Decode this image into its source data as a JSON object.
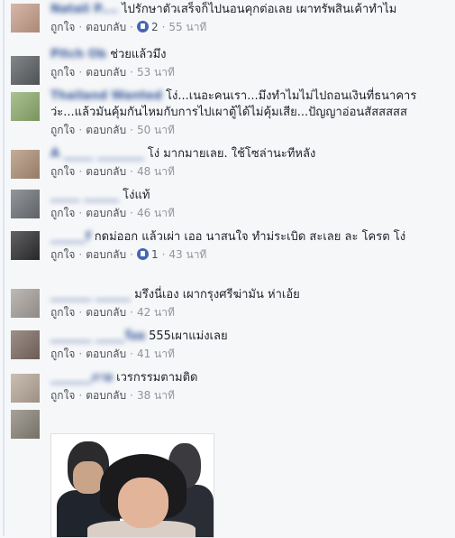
{
  "actions": {
    "like": "ถูกใจ",
    "reply": "ตอบกลับ",
    "sep": "·"
  },
  "comments": [
    {
      "name": "Natali P....",
      "text": "ไปรักษาตัวเสร็จก็ไปนอนคุกต่อเลย เผาทรัพสินเค้าทำไม",
      "likes": "2",
      "time": "55 นาที",
      "avatar_color": "#c9a08c"
    },
    {
      "name": "Pitch Ob",
      "text": "ช่วยแล้วมึง",
      "likes": "",
      "time": "53 นาที",
      "avatar_color": "#5b5f63"
    },
    {
      "name": "Thailand Wanted",
      "text": "โง่...เนอะคนเรา...มึงทำไมไม่ไปถอนเงินที่ธนาคาร ว่ะ...แล้วมันคุ้มกันไหมกับการไปเผาตู้ได้ไม่คุ้มเสีย...ปัญญาอ่อนสัสสสสส",
      "likes": "",
      "time": "50 นาที",
      "avatar_color": "#8fae6e"
    },
    {
      "name": "A _____ ________",
      "text": "โง่ มากมายเลย. ใช้โซล่านะทีหลัง",
      "likes": "",
      "time": "48 นาที",
      "avatar_color": "#b09178"
    },
    {
      "name": "_____ ______",
      "text": "โง่แท้",
      "likes": "",
      "time": "46 นาที",
      "avatar_color": "#6f7378"
    },
    {
      "name": "______f",
      "text": "กดม่ออก แล้วเผ่า เออ นาสนใจ ทำม่ระเบิด สะเลย ละ โครต โง่",
      "likes": "1",
      "time": "43 นาที",
      "avatar_color": "#2e2e31"
    },
    {
      "name": "_______ ______",
      "text": "มรึงนี่เอง เผากรุงศรีฆ่ามัน ห่าเอ้ย",
      "likes": "",
      "time": "42 นาที",
      "avatar_color": "#a8a29c"
    },
    {
      "name": "_______ _____ร้อย",
      "text": "555เผาแม่งเลย",
      "likes": "",
      "time": "41 นาที",
      "avatar_color": "#7e6b62"
    },
    {
      "name": "_______ภาย",
      "text": "เวรกรรมตามติด",
      "likes": "",
      "time": "38 นาที",
      "avatar_color": "#b9a99a"
    },
    {
      "name": "",
      "text": "",
      "likes": "",
      "time": "",
      "avatar_color": "#8a8478"
    }
  ]
}
